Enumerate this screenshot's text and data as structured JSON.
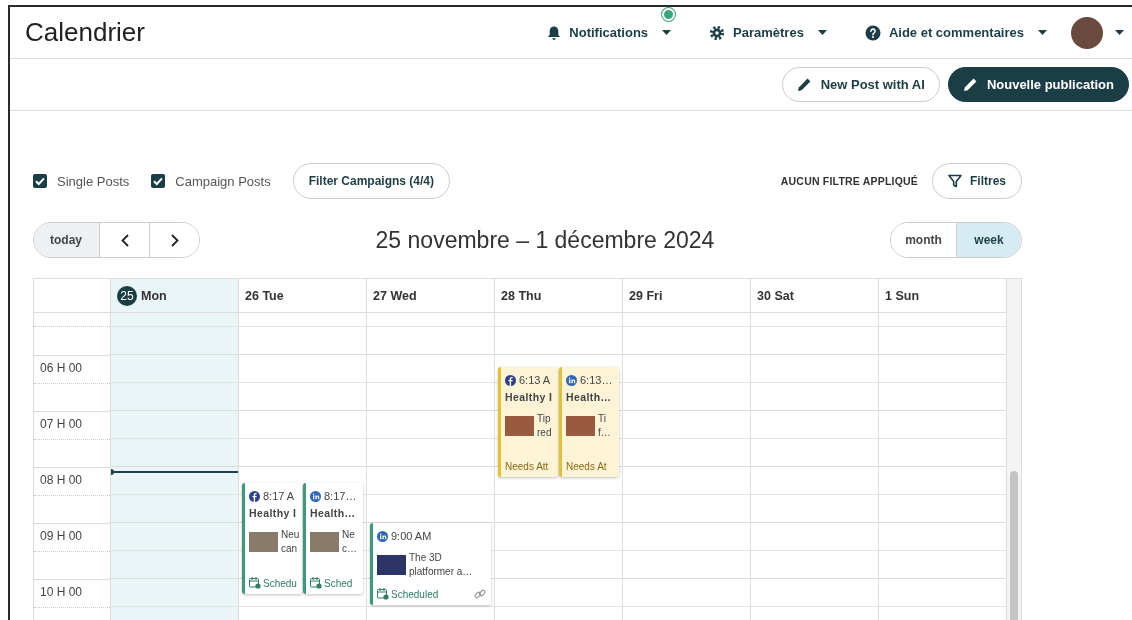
{
  "header": {
    "title": "Calendrier",
    "menus": [
      {
        "kind": "bell",
        "label": "Notifications",
        "badge": true
      },
      {
        "kind": "gear",
        "label": "Paramètres"
      },
      {
        "kind": "help",
        "label": "Aide et commentaires"
      }
    ]
  },
  "actions": [
    {
      "kind": "outline",
      "label": "New Post with AI"
    },
    {
      "kind": "primary",
      "label": "Nouvelle publication"
    }
  ],
  "filters": {
    "checkboxes": [
      {
        "label": "Single Posts",
        "checked": true
      },
      {
        "label": "Campaign Posts",
        "checked": true
      }
    ],
    "campaign_button": "Filter Campaigns (4/4)",
    "status": "AUCUN FILTRE APPLIQUÉ",
    "filter_button": "Filtres"
  },
  "navigation": {
    "today_button": "today",
    "range_title": "25 novembre – 1 décembre 2024",
    "views": [
      {
        "label": "month",
        "selected": false
      },
      {
        "label": "week",
        "selected": true
      }
    ]
  },
  "calendar": {
    "hours": [
      "06 H 00",
      "07 H 00",
      "08 H 00",
      "09 H 00",
      "10 H 00"
    ],
    "days": [
      {
        "day": "25",
        "weekday": "Mon",
        "today": true
      },
      {
        "day": "26",
        "weekday": "Tue",
        "today": false,
        "events": [
          {
            "platform": {
              "kind": "facebook"
            },
            "time": "8:17 A",
            "title": "Healthy I",
            "excerpt": [
              "Neu",
              "can"
            ],
            "status": "Schedu",
            "kind": "scheduled",
            "linked": false
          },
          {
            "platform": {
              "kind": "linkedin"
            },
            "time": "8:17…",
            "title": "Health…",
            "excerpt": [
              "Ne",
              "c…"
            ],
            "status": "Sched",
            "kind": "scheduled",
            "linked": false
          }
        ]
      },
      {
        "day": "27",
        "weekday": "Wed",
        "today": false,
        "events": [
          {
            "platform": {
              "kind": "linkedin"
            },
            "time": "9:00 AM",
            "excerpt": [
              "The 3D",
              "platformer a…"
            ],
            "status": "Scheduled",
            "kind": "scheduled",
            "linked": true
          }
        ]
      },
      {
        "day": "28",
        "weekday": "Thu",
        "today": false,
        "events": [
          {
            "platform": {
              "kind": "facebook"
            },
            "time": "6:13 A",
            "title": "Healthy I",
            "excerpt": [
              "Tip",
              "red"
            ],
            "status": "Needs Att",
            "kind": "attention",
            "linked": false
          },
          {
            "platform": {
              "kind": "linkedin"
            },
            "time": "6:13…",
            "title": "Health…",
            "excerpt": [
              "Ti",
              "f…"
            ],
            "status": "Needs At",
            "kind": "attention",
            "linked": false
          }
        ]
      },
      {
        "day": "29",
        "weekday": "Fri",
        "today": false
      },
      {
        "day": "30",
        "weekday": "Sat",
        "today": false
      },
      {
        "day": "1",
        "weekday": "Sun",
        "today": false
      }
    ]
  }
}
